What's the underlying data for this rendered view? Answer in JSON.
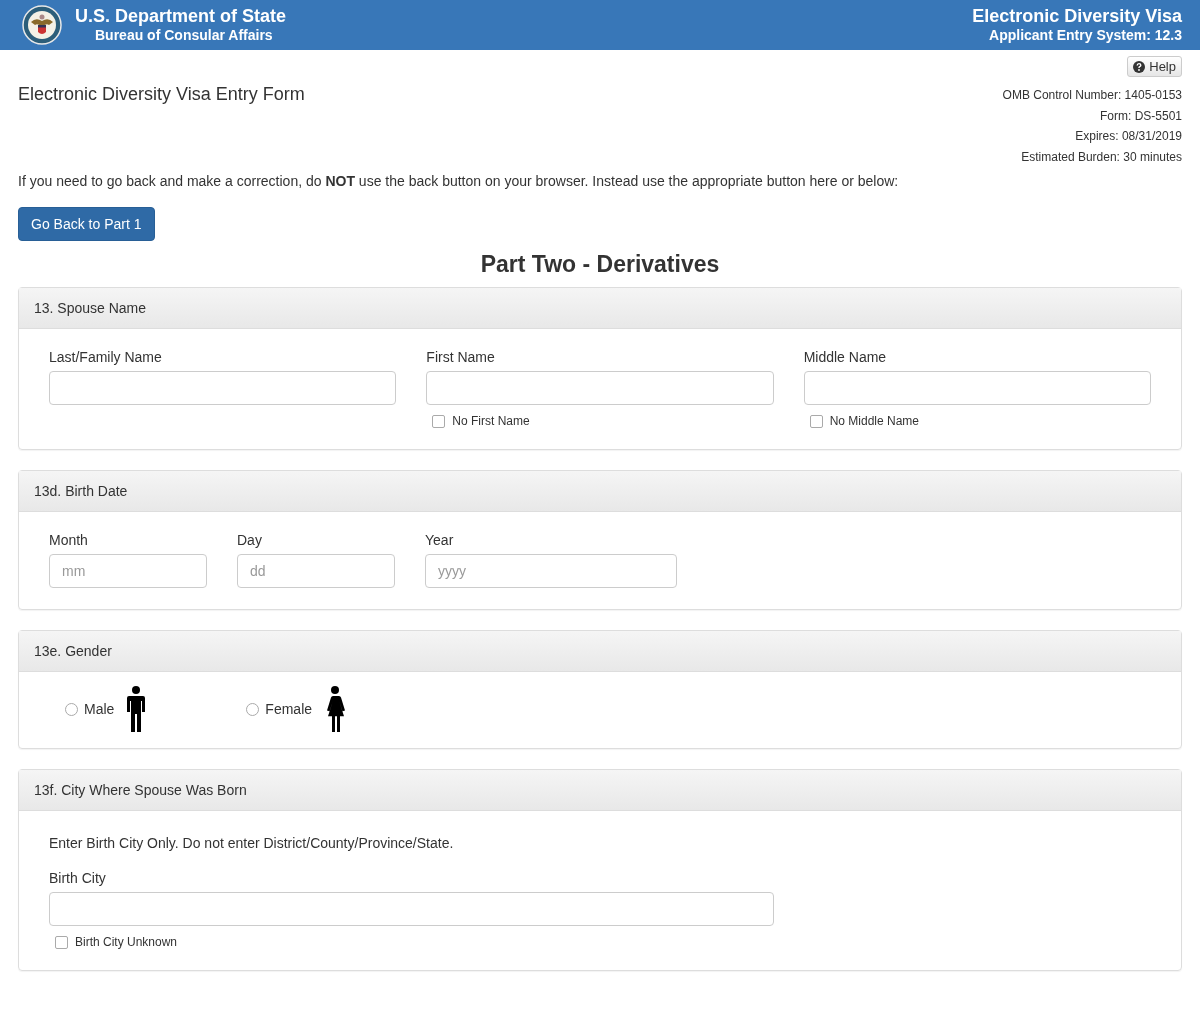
{
  "header": {
    "title": "U.S. Department of State",
    "subtitle": "Bureau of Consular Affairs",
    "system_title": "Electronic Diversity Visa",
    "system_subtitle": "Applicant Entry System: 12.3"
  },
  "help_button": "Help",
  "form_title": "Electronic Diversity Visa Entry Form",
  "omb_info": [
    "OMB Control Number: 1405-0153",
    "Form: DS-5501",
    "Expires: 08/31/2019",
    "Estimated Burden: 30 minutes"
  ],
  "notice": "If you need to go back and make a correction, do **NOT** use the back button on your browser. Instead use the appropriate button here or below:",
  "back_button": "Go Back to Part 1",
  "part_title": "Part Two - Derivatives",
  "sections": [
    {
      "kind": "name",
      "title": "13. Spouse Name",
      "fields": [
        {
          "label": "Last/Family Name"
        },
        {
          "label": "First Name",
          "checkbox": {
            "label": "No First Name",
            "checked": false
          }
        },
        {
          "label": "Middle Name",
          "checkbox": {
            "label": "No Middle Name",
            "checked": false
          }
        }
      ]
    },
    {
      "kind": "date",
      "title": "13d. Birth Date",
      "fields": [
        {
          "label": "Month",
          "placeholder": "mm"
        },
        {
          "label": "Day",
          "placeholder": "dd"
        },
        {
          "label": "Year",
          "placeholder": "yyyy"
        }
      ]
    },
    {
      "kind": "gender",
      "title": "13e. Gender",
      "options": [
        {
          "label": "Male",
          "kind": "male",
          "selected": false
        },
        {
          "label": "Female",
          "kind": "female",
          "selected": false
        }
      ]
    },
    {
      "kind": "city",
      "title": "13f. City Where Spouse Was Born",
      "hint": "Enter Birth City Only. Do not enter District/County/Province/State.",
      "fields": [
        {
          "label": "Birth City",
          "checkbox": {
            "label": "Birth City Unknown",
            "checked": false
          }
        }
      ]
    }
  ]
}
